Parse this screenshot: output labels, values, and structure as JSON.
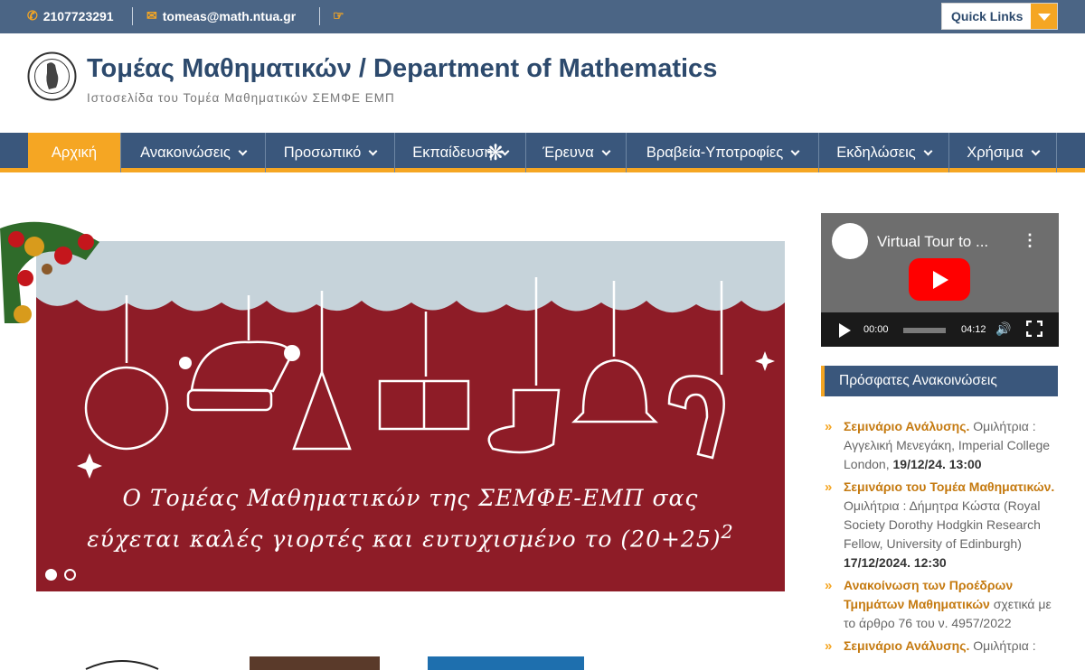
{
  "topbar": {
    "phone": "2107723291",
    "email": "tomeas@math.ntua.gr",
    "quick_links": "Quick Links"
  },
  "header": {
    "title": "Τομέας Μαθηματικών / Department of Mathematics",
    "subtitle": "Ιστοσελίδα του Τομέα Μαθηματικών ΣΕΜΦΕ ΕΜΠ"
  },
  "nav": {
    "items": [
      {
        "label": "Αρχική"
      },
      {
        "label": "Ανακοινώσεις"
      },
      {
        "label": "Προσωπικό"
      },
      {
        "label": "Εκπαίδευση"
      },
      {
        "label": "Έρευνα"
      },
      {
        "label": "Βραβεία-Υποτροφίες"
      },
      {
        "label": "Εκδηλώσεις"
      },
      {
        "label": "Χρήσιμα"
      }
    ]
  },
  "slider": {
    "line1": "Ο Τομέας Μαθηματικών της ΣΕΜΦΕ-ΕΜΠ σας",
    "line2": "εύχεται καλές γιορτές και ευτυχισμένο το (20+25)",
    "superscript": "2"
  },
  "video": {
    "title": "Virtual Tour to ...",
    "current_time": "00:00",
    "duration": "04:12"
  },
  "announcements": {
    "heading": "Πρόσφατες Ανακοινώσεις",
    "items": [
      {
        "title": "Σεμινάριο Ανάλυσης.",
        "body": " Ομιλήτρια : Αγγελική Μενεγάκη, Imperial College London, ",
        "date": "19/12/24. 13:00"
      },
      {
        "title": "Σεμινάριο του Τομέα Μαθηματικών.",
        "body": " Ομιλήτρια : Δήμητρα Κώστα (Royal Society Dorothy Hodgkin Research Fellow, University of Edinburgh) ",
        "date": "17/12/2024. 12:30"
      },
      {
        "title": "Ανακοίνωση των Προέδρων Τμημάτων Μαθηματικών",
        "body": " σχετικά με το άρθρο 76 του ν. 4957/2022",
        "date": ""
      },
      {
        "title": "Σεμινάριο Ανάλυσης.",
        "body": " Ομιλήτρια :",
        "date": ""
      }
    ]
  },
  "colors": {
    "primary": "#3a577c",
    "accent": "#f5a623",
    "slider_bg": "#8e1c27"
  }
}
